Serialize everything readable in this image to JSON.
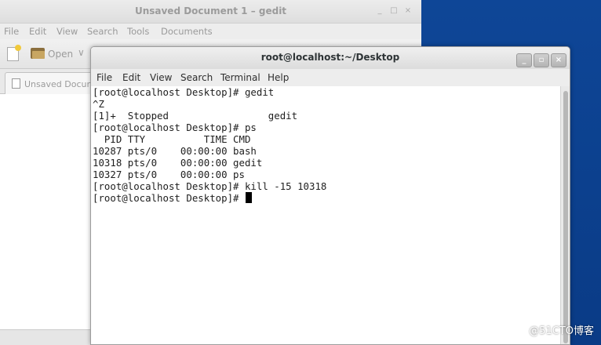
{
  "gedit": {
    "title": "Unsaved Document 1 – gedit",
    "window_buttons": [
      "_",
      "□",
      "×"
    ],
    "menu": [
      "File",
      "Edit",
      "View",
      "Search",
      "Tools",
      "Documents"
    ],
    "toolbar": {
      "open_label": "Open",
      "open_arrow": "∨"
    },
    "tab": {
      "label": "Unsaved Docum"
    }
  },
  "terminal": {
    "title": "root@localhost:~/Desktop",
    "window_buttons": [
      "_",
      "▫",
      "×"
    ],
    "menu": [
      "File",
      "Edit",
      "View",
      "Search",
      "Terminal",
      "Help"
    ],
    "lines": [
      "[root@localhost Desktop]# gedit",
      "^Z",
      "[1]+  Stopped                 gedit",
      "[root@localhost Desktop]# ps",
      "  PID TTY          TIME CMD",
      "10287 pts/0    00:00:00 bash",
      "10318 pts/0    00:00:00 gedit",
      "10327 pts/0    00:00:00 ps",
      "[root@localhost Desktop]# kill -15 10318"
    ],
    "prompt": "[root@localhost Desktop]# "
  },
  "watermark": "@51CTO博客"
}
